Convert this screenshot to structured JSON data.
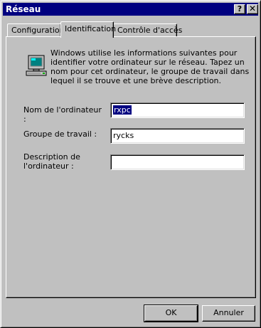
{
  "window": {
    "title": "Réseau"
  },
  "titlebar_buttons": {
    "help": "?",
    "close": "✕"
  },
  "tabs": [
    {
      "label": "Configuration",
      "active": false
    },
    {
      "label": "Identification",
      "active": true
    },
    {
      "label": "Contrôle d'accès",
      "active": false
    }
  ],
  "identification": {
    "description": "Windows utilise les informations suivantes pour identifier votre ordinateur sur le réseau. Tapez un nom pour cet ordinateur, le groupe de travail dans lequel il se trouve et une brève description.",
    "computer_name": {
      "label": "Nom de l'ordinateur :",
      "value": "rxpc"
    },
    "workgroup": {
      "label": "Groupe de travail :",
      "value": "rycks"
    },
    "computer_description": {
      "label_line1": "Description de",
      "label_line2": "l'ordinateur :",
      "value": ""
    }
  },
  "buttons": {
    "ok": "OK",
    "cancel": "Annuler"
  },
  "icon": "network-computer-icon"
}
